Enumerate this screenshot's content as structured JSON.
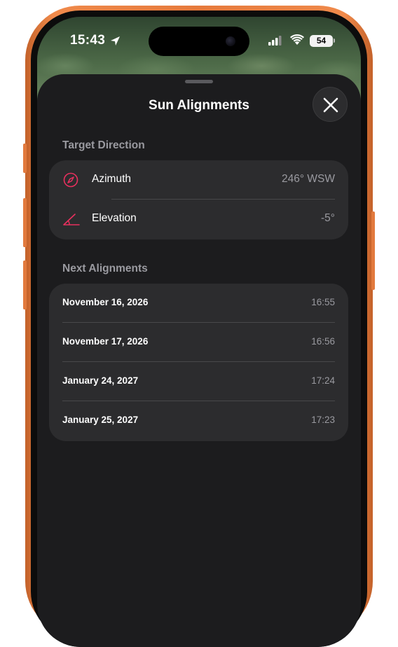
{
  "status_bar": {
    "time": "15:43",
    "battery": "54",
    "icons": [
      "location-arrow-icon",
      "cellular-signal-icon",
      "wifi-icon",
      "battery-icon"
    ]
  },
  "sheet": {
    "title": "Sun Alignments",
    "close_icon": "close-icon"
  },
  "target_direction": {
    "header": "Target Direction",
    "rows": [
      {
        "label": "Azimuth",
        "value": "246° WSW",
        "icon": "compass-icon"
      },
      {
        "label": "Elevation",
        "value": "-5°",
        "icon": "angle-icon"
      }
    ]
  },
  "next_alignments": {
    "header": "Next Alignments",
    "items": [
      {
        "date": "November 16, 2026",
        "time": "16:55"
      },
      {
        "date": "November 17, 2026",
        "time": "16:56"
      },
      {
        "date": "January 24, 2027",
        "time": "17:24"
      },
      {
        "date": "January 25, 2027",
        "time": "17:23"
      }
    ]
  },
  "colors": {
    "accent_icon": "#e8305e",
    "frame": "#e67a3c",
    "sheet_background": "#1c1c1e",
    "card_background": "#2c2c2e"
  }
}
